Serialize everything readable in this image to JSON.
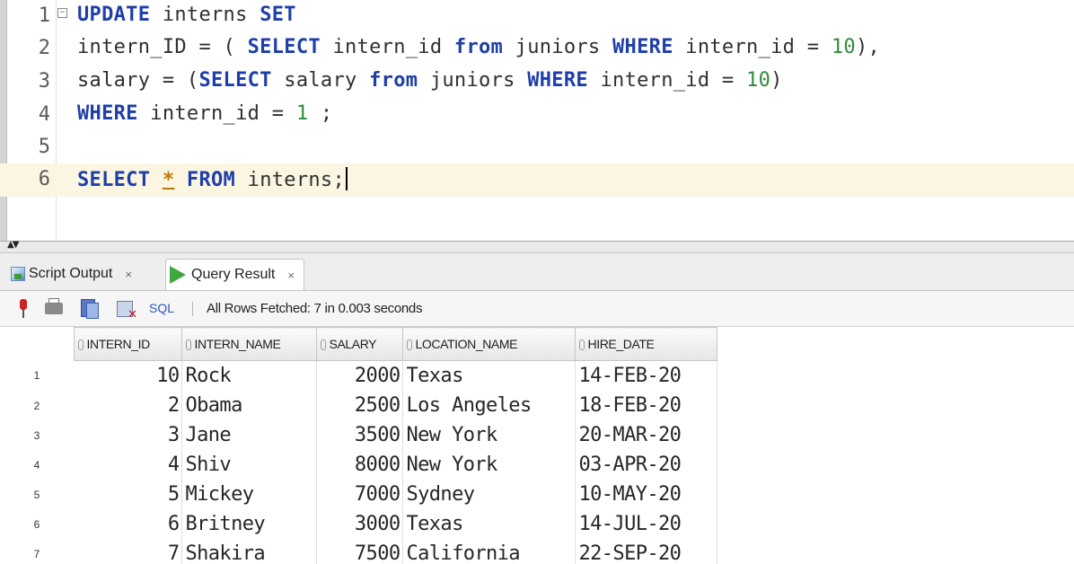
{
  "editor": {
    "lines": [
      {
        "n": "1",
        "tokens": [
          {
            "t": "UPDATE",
            "c": "kw"
          },
          {
            "t": " interns "
          },
          {
            "t": "SET",
            "c": "kw"
          }
        ]
      },
      {
        "n": "2",
        "tokens": [
          {
            "t": "intern_ID = ( "
          },
          {
            "t": "SELECT",
            "c": "kw"
          },
          {
            "t": " intern_id "
          },
          {
            "t": "from",
            "c": "kw"
          },
          {
            "t": " juniors "
          },
          {
            "t": "WHERE",
            "c": "kw"
          },
          {
            "t": " intern_id = "
          },
          {
            "t": "10",
            "c": "num"
          },
          {
            "t": "),"
          }
        ]
      },
      {
        "n": "3",
        "tokens": [
          {
            "t": "salary = ("
          },
          {
            "t": "SELECT",
            "c": "kw"
          },
          {
            "t": " salary "
          },
          {
            "t": "from",
            "c": "kw"
          },
          {
            "t": " juniors "
          },
          {
            "t": "WHERE",
            "c": "kw"
          },
          {
            "t": " intern_id = "
          },
          {
            "t": "10",
            "c": "num"
          },
          {
            "t": ")"
          }
        ]
      },
      {
        "n": "4",
        "tokens": [
          {
            "t": "WHERE",
            "c": "kw"
          },
          {
            "t": " intern_id = "
          },
          {
            "t": "1",
            "c": "num"
          },
          {
            "t": " ;"
          }
        ]
      },
      {
        "n": "5",
        "tokens": []
      },
      {
        "n": "6",
        "tokens": [
          {
            "t": "SELECT",
            "c": "kw"
          },
          {
            "t": " "
          },
          {
            "t": "*",
            "c": "star"
          },
          {
            "t": " "
          },
          {
            "t": "FROM",
            "c": "kw"
          },
          {
            "t": " interns;"
          }
        ]
      }
    ]
  },
  "tabs": {
    "script_output": {
      "label": "Script Output",
      "close": "×"
    },
    "query_result": {
      "label": "Query Result",
      "close": "×"
    }
  },
  "toolbar": {
    "sql_label": "SQL",
    "status": "All Rows Fetched: 7 in 0.003 seconds"
  },
  "result": {
    "columns": [
      "INTERN_ID",
      "INTERN_NAME",
      "SALARY",
      "LOCATION_NAME",
      "HIRE_DATE"
    ],
    "rows": [
      {
        "rn": "1",
        "intern_id": "10",
        "intern_name": "Rock",
        "salary": "2000",
        "location_name": "Texas",
        "hire_date": "14-FEB-20"
      },
      {
        "rn": "2",
        "intern_id": "2",
        "intern_name": "Obama",
        "salary": "2500",
        "location_name": "Los Angeles",
        "hire_date": "18-FEB-20"
      },
      {
        "rn": "3",
        "intern_id": "3",
        "intern_name": "Jane",
        "salary": "3500",
        "location_name": "New York",
        "hire_date": "20-MAR-20"
      },
      {
        "rn": "4",
        "intern_id": "4",
        "intern_name": "Shiv",
        "salary": "8000",
        "location_name": "New York",
        "hire_date": "03-APR-20"
      },
      {
        "rn": "5",
        "intern_id": "5",
        "intern_name": "Mickey",
        "salary": "7000",
        "location_name": "Sydney",
        "hire_date": "10-MAY-20"
      },
      {
        "rn": "6",
        "intern_id": "6",
        "intern_name": "Britney",
        "salary": "3000",
        "location_name": "Texas",
        "hire_date": "14-JUL-20"
      },
      {
        "rn": "7",
        "intern_id": "7",
        "intern_name": "Shakira",
        "salary": "7500",
        "location_name": "California",
        "hire_date": "22-SEP-20"
      }
    ]
  },
  "colors": {
    "keyword": "#1f3fa8",
    "number": "#2e8b3a",
    "current_line": "#fbf6e2"
  }
}
